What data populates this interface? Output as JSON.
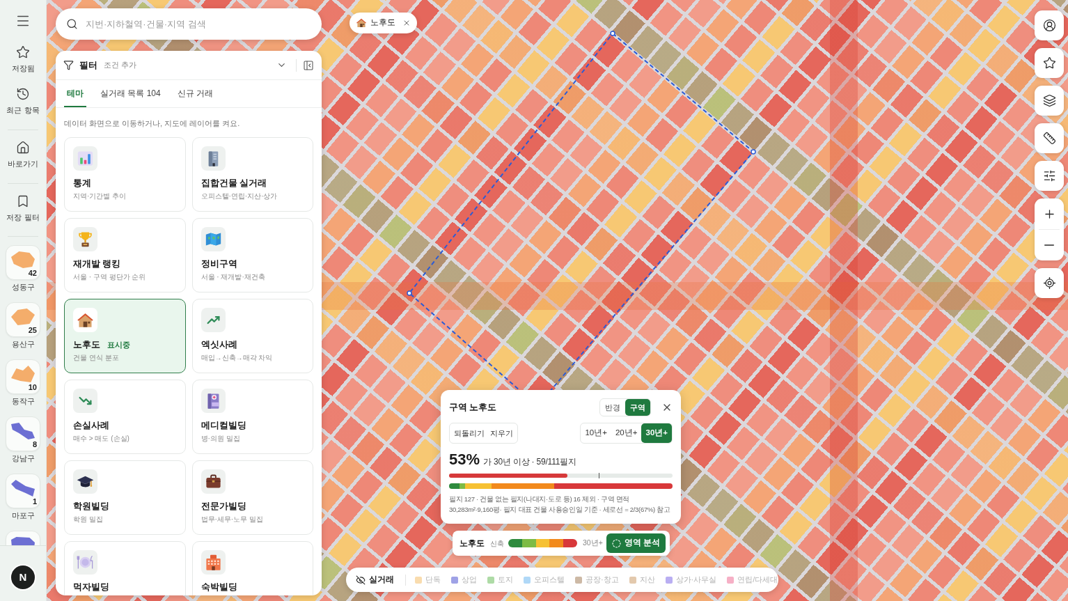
{
  "rail": {
    "groups": [
      {
        "items": [
          {
            "label": "저장됨"
          },
          {
            "label": "최근 항목"
          }
        ]
      },
      {
        "items": [
          {
            "label": "바로가기"
          }
        ]
      },
      {
        "items": [
          {
            "label": "저장 필터"
          }
        ]
      }
    ],
    "regions": [
      {
        "name": "성동구",
        "count": "42",
        "color": "#f4ad6b"
      },
      {
        "name": "용산구",
        "count": "25",
        "color": "#f4ad6b"
      },
      {
        "name": "동작구",
        "count": "10",
        "color": "#f4ad6b"
      },
      {
        "name": "강남구",
        "count": "8",
        "color": "#6c6fd3"
      },
      {
        "name": "마포구",
        "count": "1",
        "color": "#6c6fd3"
      },
      {
        "color": "#6c6fd3"
      }
    ],
    "account": {
      "initial": "N"
    }
  },
  "search": {
    "placeholder": "지번·지하철역·건물·지역 검색"
  },
  "layer_chip": {
    "label": "노후도"
  },
  "panel": {
    "filter": {
      "label": "필터",
      "hint": "조건 추가"
    },
    "tabs": [
      {
        "label": "테마",
        "selected": true
      },
      {
        "label": "실거래 목록 104",
        "selected": false
      },
      {
        "label": "신규 거래",
        "selected": false
      }
    ],
    "description": "데이터 화면으로 이동하거나, 지도에 레이어를 켜요.",
    "cards": [
      {
        "title": "통계",
        "subtitle": "지역·기간별 추이",
        "selected": false
      },
      {
        "title": "집합건물 실거래",
        "subtitle": "오피스텔·연립·지산·상가",
        "selected": false
      },
      {
        "title": "재개발 랭킹",
        "subtitle": "서울 · 구역 평단가 순위",
        "selected": false
      },
      {
        "title": "정비구역",
        "subtitle": "서울 · 재개발·재건축",
        "selected": false
      },
      {
        "title": "노후도",
        "badge": "표시중",
        "subtitle": "건물 연식 분포",
        "selected": true
      },
      {
        "title": "엑싯사례",
        "subtitle": "매입→신축→매각 차익",
        "selected": false
      },
      {
        "title": "손실사례",
        "subtitle": "매수 > 매도 (손실)",
        "selected": false
      },
      {
        "title": "메디컬빌딩",
        "subtitle": "병·의원 밀집",
        "selected": false
      },
      {
        "title": "학원빌딩",
        "subtitle": "학원 밀집",
        "selected": false
      },
      {
        "title": "전문가빌딩",
        "subtitle": "법무·세무·노무 밀집",
        "selected": false
      },
      {
        "title": "먹자빌딩",
        "selected": false
      },
      {
        "title": "숙박빌딩",
        "selected": false
      }
    ]
  },
  "area_popup": {
    "title": "구역 노후도",
    "modes": [
      {
        "label": "반경",
        "selected": false
      },
      {
        "label": "구역",
        "selected": true
      }
    ],
    "actions": [
      "되돌리기",
      "지우기"
    ],
    "age_options": [
      {
        "label": "10년+",
        "selected": false
      },
      {
        "label": "20년+",
        "selected": false
      },
      {
        "label": "30년+",
        "selected": true
      }
    ],
    "share": "53%",
    "share_caption": "가 30년 이상 · 59/111필지",
    "share_bar": {
      "level": 0.53
    },
    "reference_mark": {
      "level": 0.67
    },
    "note": "필지 127 · 건물 없는 필지(나대지·도로 등) 16 제외 · 구역 면적 30,283m²·9,160평· 필지 대표 건물 사용승인일 기준 · 세로선 = 2/3(67%) 참고"
  },
  "age_legend": {
    "title": "노후도",
    "start": "신축",
    "end": "30년+",
    "scale": [
      {
        "color": "#2e8b3e"
      },
      {
        "color": "#7dbb45"
      },
      {
        "color": "#f6c133"
      },
      {
        "color": "#f28a1c"
      },
      {
        "color": "#d8383a"
      }
    ],
    "action": "영역 분석"
  },
  "deal_legend": {
    "layer": "실거래",
    "visible": false,
    "items": [
      {
        "label": "단독",
        "color": "#f9dcae"
      },
      {
        "label": "상업",
        "color": "#9fa2e6"
      },
      {
        "label": "토지",
        "color": "#aedba6"
      },
      {
        "label": "오피스텔",
        "color": "#b0d8f7"
      },
      {
        "label": "공장·창고",
        "color": "#cdb9a5"
      },
      {
        "label": "지산",
        "color": "#e3c9ad"
      },
      {
        "label": "상가·사무실",
        "color": "#b9aef2"
      },
      {
        "label": "연립/다세대",
        "color": "#f6b0c6"
      }
    ]
  }
}
